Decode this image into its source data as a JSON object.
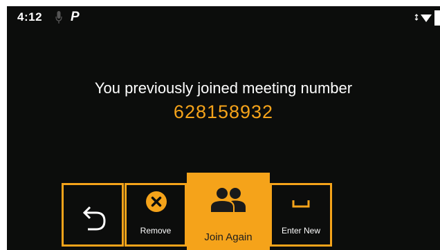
{
  "status_bar": {
    "time": "4:12",
    "app_glyph": "P",
    "icons": [
      "microphone-icon",
      "wifi-icon",
      "battery-icon"
    ]
  },
  "prompt": {
    "message": "You previously joined meeting number",
    "meeting_number": "628158932"
  },
  "actions": {
    "back_icon": "undo-arrow-icon",
    "remove": {
      "label": "Remove",
      "icon": "close-circle-icon"
    },
    "join_again": {
      "label": "Join Again",
      "icon": "people-icon"
    },
    "enter_new": {
      "label": "Enter New",
      "icon": "space-bar-icon"
    }
  },
  "colors": {
    "background": "#0c0d0c",
    "accent": "#f5a31a",
    "text": "#ffffff"
  }
}
